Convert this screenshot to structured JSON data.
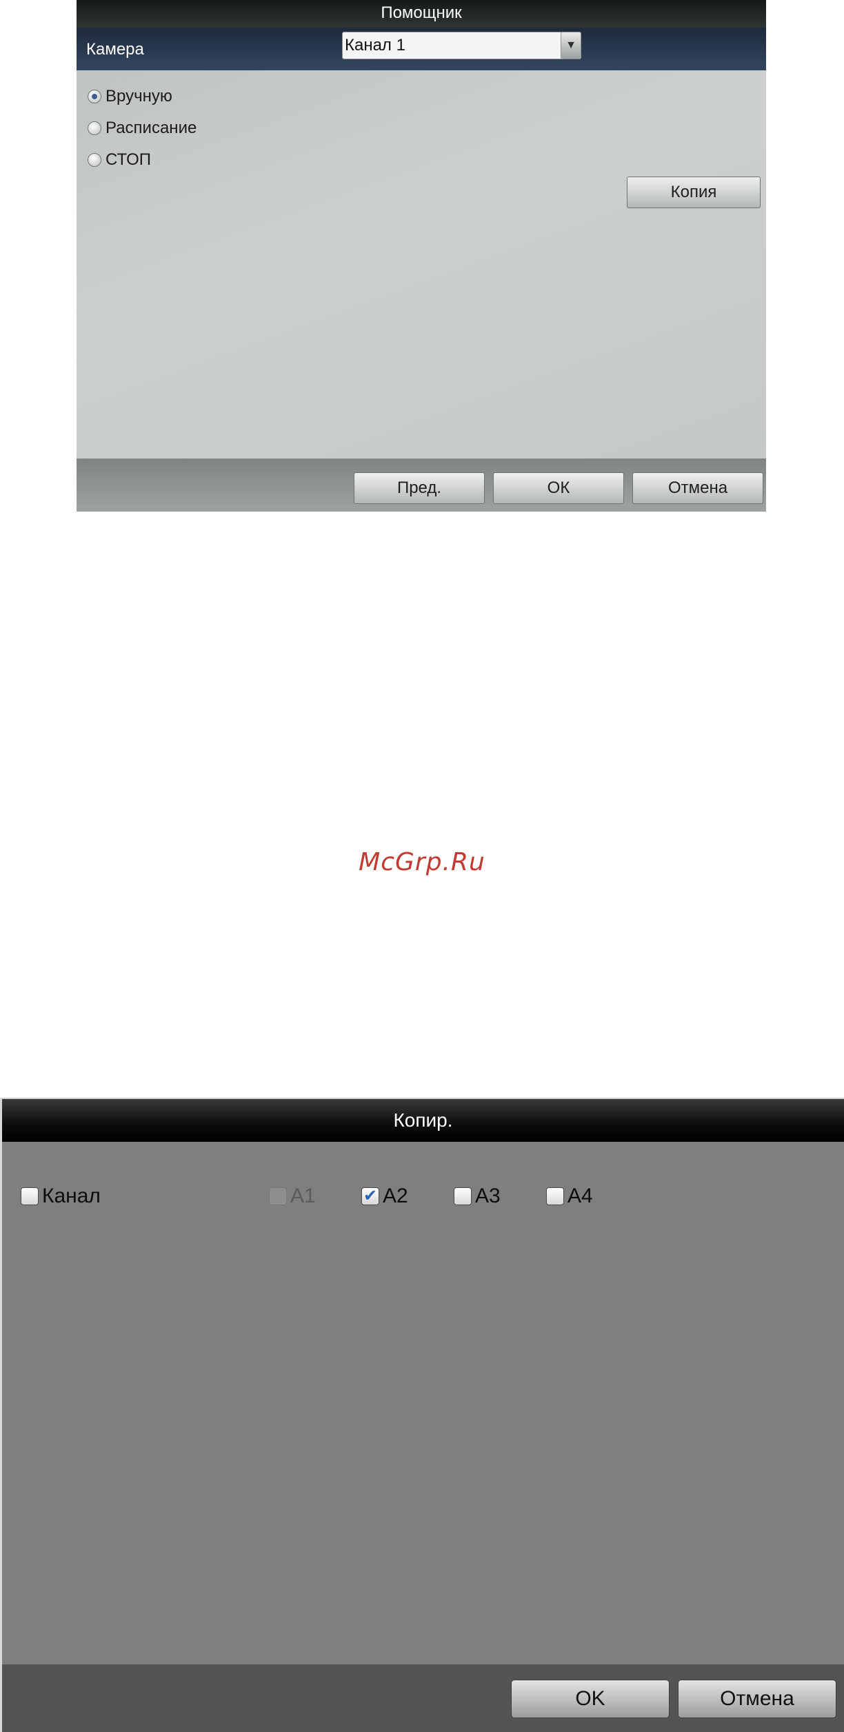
{
  "wizard": {
    "title": "Помощник",
    "camera_label": "Камера",
    "camera_value": "Канал 1",
    "modes": [
      {
        "label": "Вручную",
        "selected": true
      },
      {
        "label": "Расписание",
        "selected": false
      },
      {
        "label": "СТОП",
        "selected": false
      }
    ],
    "copy_label": "Копия",
    "prev_label": "Пред.",
    "ok_label": "ОК",
    "cancel_label": "Отмена"
  },
  "watermark": "McGrp.Ru",
  "copy_dialog": {
    "title": "Копир.",
    "channel_label": "Канал",
    "channels": [
      {
        "label": "A1",
        "checked": false,
        "disabled": true
      },
      {
        "label": "A2",
        "checked": true,
        "disabled": false
      },
      {
        "label": "A3",
        "checked": false,
        "disabled": false
      },
      {
        "label": "A4",
        "checked": false,
        "disabled": false
      }
    ],
    "ok_label": "OK",
    "cancel_label": "Отмена"
  },
  "colors": {
    "check_mark": "#2c63b4",
    "radio_dot": "#3e5b8a",
    "watermark": "#c23b32"
  }
}
